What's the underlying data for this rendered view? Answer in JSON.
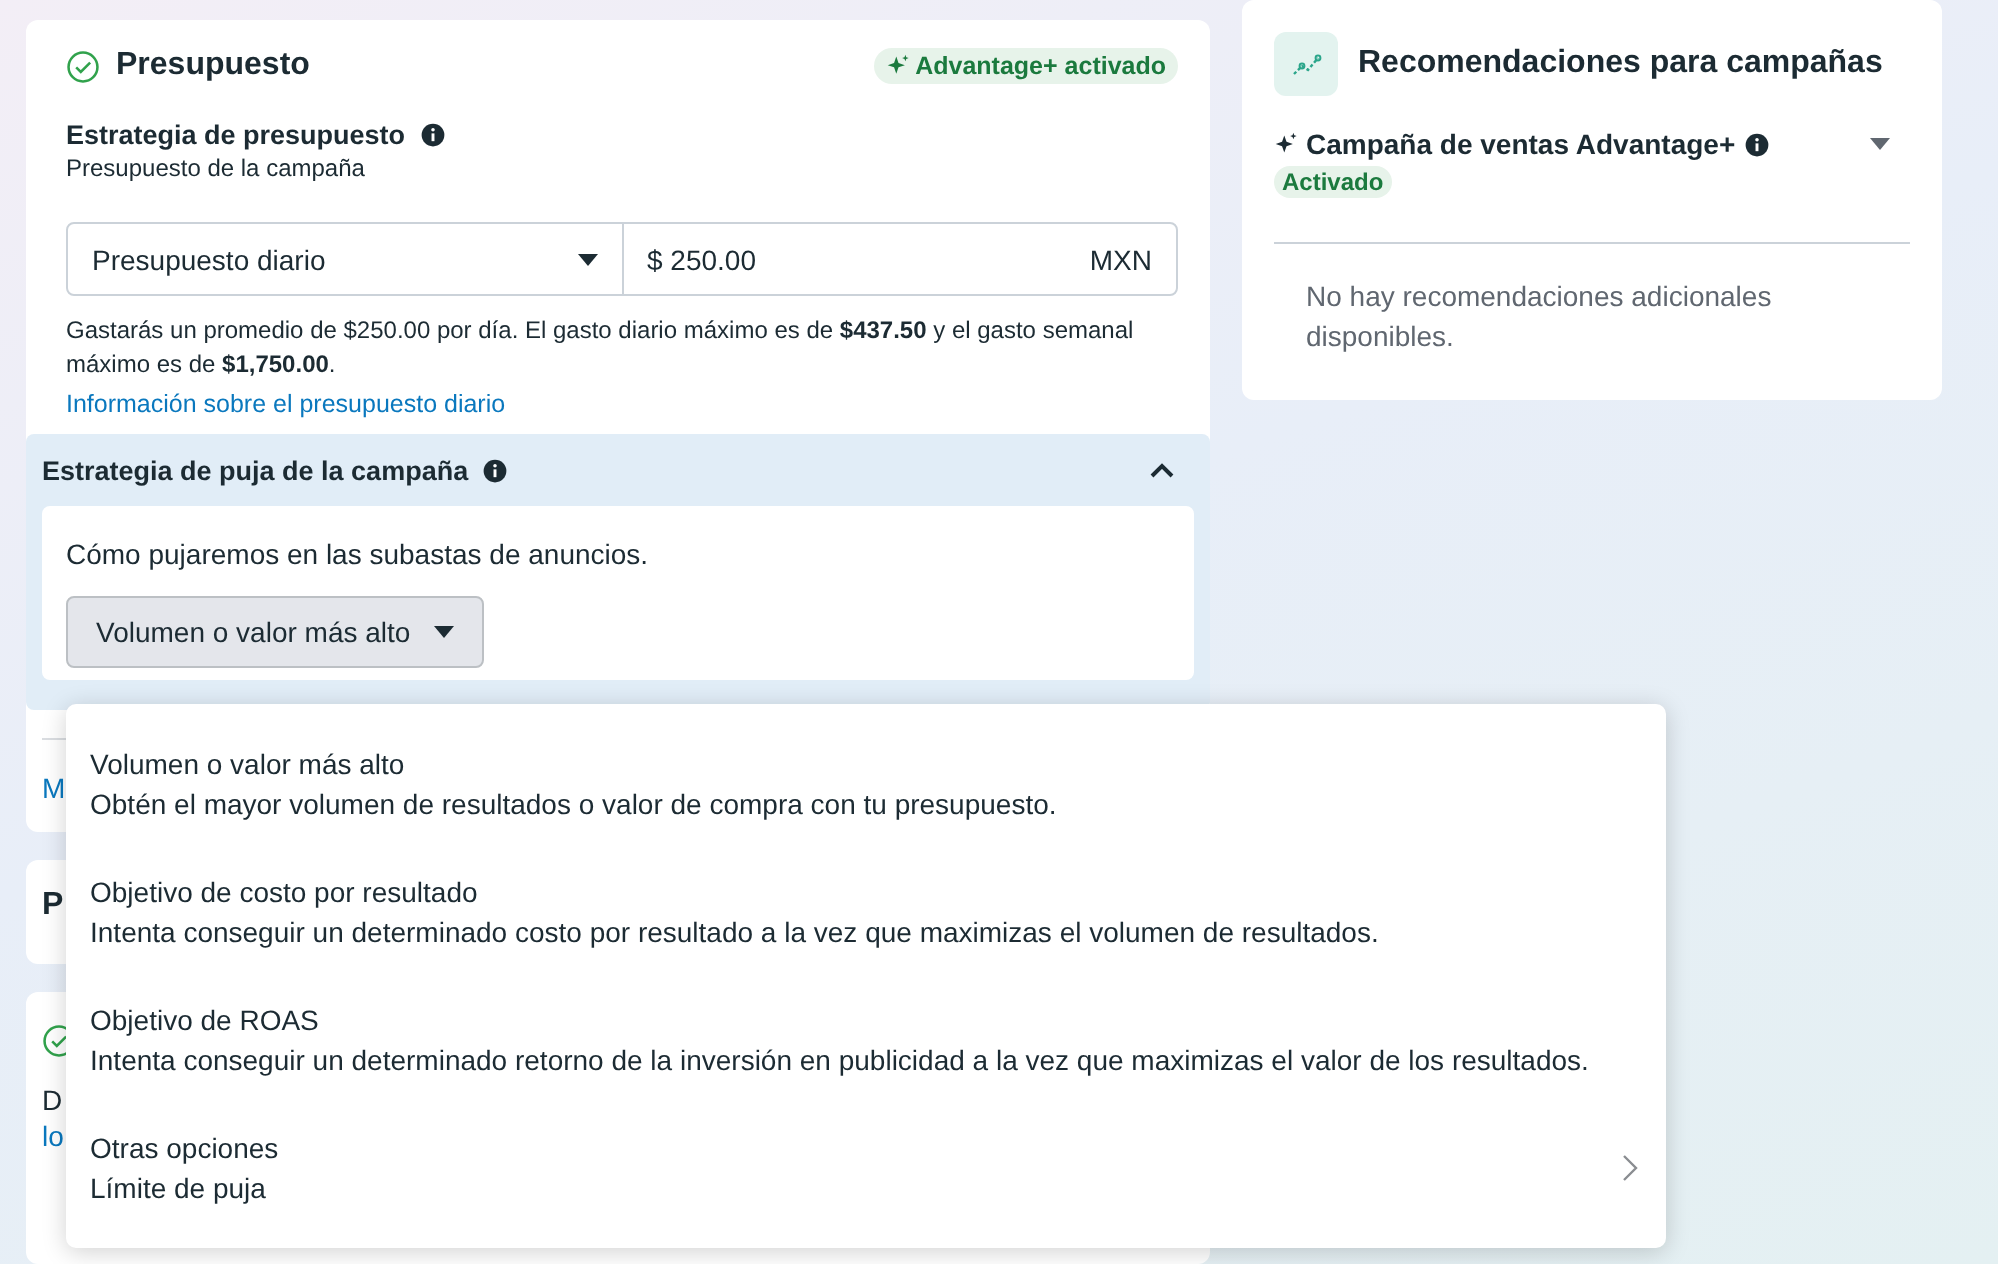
{
  "budget_card": {
    "title": "Presupuesto",
    "checked": true,
    "badge": "Advantage+ activado",
    "strategy_label": "Estrategia de presupuesto",
    "strategy_sub": "Presupuesto de la campaña",
    "budget_type": "Presupuesto diario",
    "amount": "$ 250.00",
    "currency": "MXN",
    "help_text": "Gastarás un promedio de $250.00 por día. El gasto diario máximo es de **$437.50** y el gasto semanal máximo es de **$1,750.00**.",
    "help_link": "Información sobre el presupuesto diario",
    "bid_section": {
      "title": "Estrategia de puja de la campaña",
      "expanded": true,
      "description": "Cómo pujaremos en las subastas de anuncios.",
      "dropdown": "Volumen o valor más alto"
    },
    "more_link": "M"
  },
  "card_2": {
    "title": "P"
  },
  "card_3": {
    "checked": true,
    "text": "D",
    "link": "lo"
  },
  "bid_menu": {
    "options": [
      {
        "title": "Volumen o valor más alto",
        "description": "Obtén el mayor volumen de resultados o valor de compra con tu presupuesto.",
        "has_submenu": false
      },
      {
        "title": "Objetivo de costo por resultado",
        "description": "Intenta conseguir un determinado costo por resultado a la vez que maximizas el volumen de resultados.",
        "has_submenu": false
      },
      {
        "title": "Objetivo de ROAS",
        "description": "Intenta conseguir un determinado retorno de la inversión en publicidad a la vez que maximizas el valor de los resultados.",
        "has_submenu": false
      },
      {
        "title": "Otras opciones",
        "description": "Límite de puja",
        "has_submenu": true
      }
    ]
  },
  "recommendations": {
    "title": "Recomendaciones para campañas",
    "item": {
      "title": "Campaña de ventas Advantage+",
      "status": "Activado",
      "expanded": false
    },
    "empty_text": "No hay recomendaciones adicionales disponibles."
  }
}
